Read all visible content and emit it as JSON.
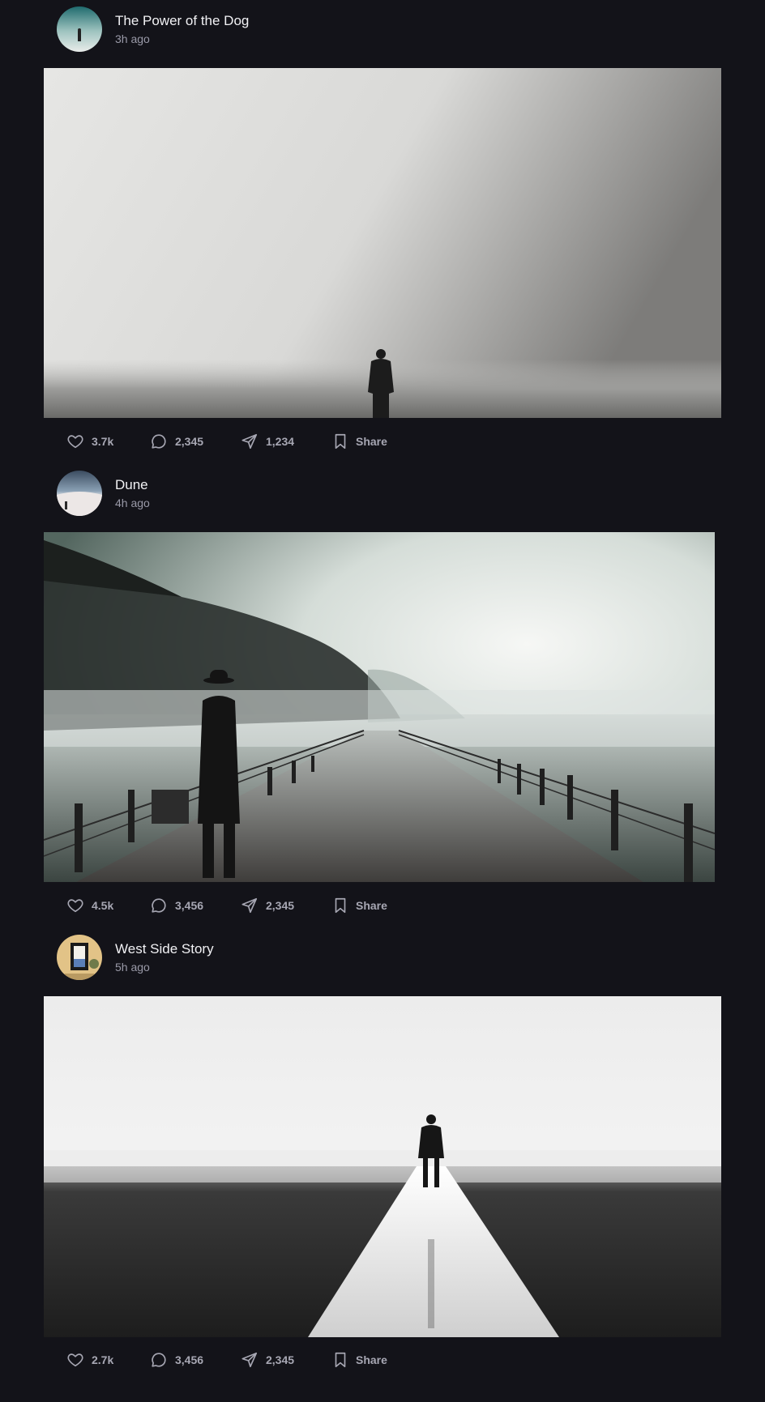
{
  "posts": [
    {
      "title": "The Power of the Dog",
      "time": "3h ago",
      "likes": "3.7k",
      "comments": "2,345",
      "sends": "1,234",
      "share_label": "Share"
    },
    {
      "title": "Dune",
      "time": "4h ago",
      "likes": "4.5k",
      "comments": "3,456",
      "sends": "2,345",
      "share_label": "Share"
    },
    {
      "title": "West Side Story",
      "time": "5h ago",
      "likes": "2.7k",
      "comments": "3,456",
      "sends": "2,345",
      "share_label": "Share"
    }
  ],
  "icons": {
    "like": "heart-icon",
    "comment": "comment-icon",
    "send": "send-icon",
    "share": "bookmark-icon"
  },
  "colors": {
    "background": "#131319",
    "title": "#f1f1f4",
    "muted": "#9a9aa8",
    "action": "#a7a7b3"
  }
}
